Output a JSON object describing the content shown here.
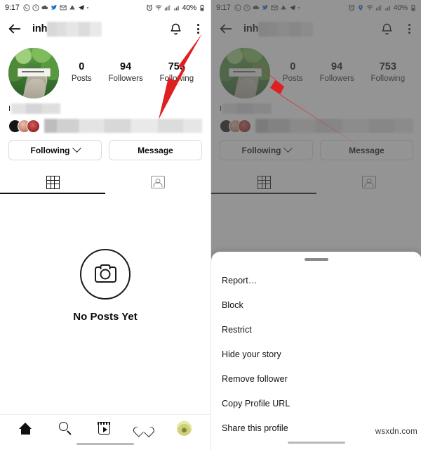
{
  "meta": {
    "watermark": "wsxdn.com",
    "accent_red": "#e02020",
    "dim_color": "rgba(82,82,82,0.62)"
  },
  "status_bar": {
    "time": "9:17",
    "left_icons": [
      "whatsapp-icon",
      "clock-icon",
      "cloud-upload-icon",
      "twitter-icon",
      "gmail-icon",
      "drive-icon",
      "telegram-icon",
      "more-dot-icon"
    ],
    "right_icons": [
      "alarm-icon",
      "location-icon",
      "wifi-icon",
      "signal-dual-icon",
      "signal-bars-icon"
    ],
    "battery_text": "40%",
    "battery_icon": "battery-icon"
  },
  "header": {
    "back_icon": "back-arrow-icon",
    "username_visible": "inh",
    "username_redacted": true,
    "bell_icon": "bell-icon",
    "menu_icon": "kebab-menu-icon"
  },
  "profile": {
    "avatar_name": "profile-avatar",
    "stats": [
      {
        "value": "0",
        "label": "Posts"
      },
      {
        "value": "94",
        "label": "Followers"
      },
      {
        "value": "753",
        "label": "Following"
      }
    ],
    "bio_prefix": "I",
    "bio_redacted": true,
    "mutual_redacted": true
  },
  "actions": {
    "following_label": "Following",
    "following_chevron": "chevron-down-icon",
    "message_label": "Message"
  },
  "tabs": [
    {
      "name": "grid-tab",
      "icon": "grid-icon",
      "active": true
    },
    {
      "name": "tagged-tab",
      "icon": "tagged-person-icon",
      "active": false
    }
  ],
  "empty_state": {
    "icon": "camera-icon",
    "title": "No Posts Yet"
  },
  "bottom_nav": [
    {
      "name": "nav-home",
      "icon": "home-icon"
    },
    {
      "name": "nav-search",
      "icon": "search-icon"
    },
    {
      "name": "nav-reels",
      "icon": "reels-icon"
    },
    {
      "name": "nav-activity",
      "icon": "heart-icon"
    },
    {
      "name": "nav-profile",
      "icon": "avatar-icon"
    }
  ],
  "sheet": {
    "handle": "drag-handle",
    "items": [
      {
        "label": "Report…"
      },
      {
        "label": "Block"
      },
      {
        "label": "Restrict"
      },
      {
        "label": "Hide your story"
      },
      {
        "label": "Remove follower"
      },
      {
        "label": "Copy Profile URL"
      },
      {
        "label": "Share this profile"
      }
    ]
  },
  "annotations": [
    {
      "name": "arrow-to-kebab-menu",
      "panel": "left",
      "points_to": "kebab-menu-icon"
    },
    {
      "name": "arrow-to-block-item",
      "panel": "right",
      "points_to": "Block"
    }
  ]
}
